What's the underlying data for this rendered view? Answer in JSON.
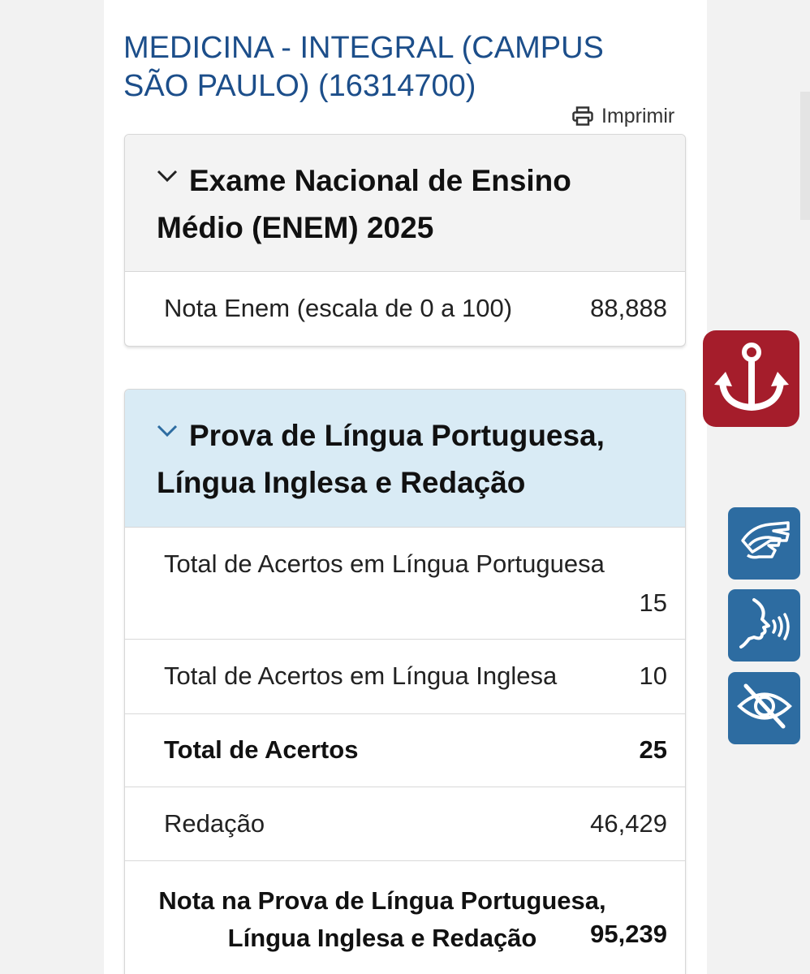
{
  "course": {
    "title": "MEDICINA - INTEGRAL (CAMPUS SÃO PAULO) (16314700)"
  },
  "print": {
    "label": "Imprimir",
    "icon": "printer-icon"
  },
  "enem_section": {
    "title": "Exame Nacional de Ensino Médio (ENEM) 2025",
    "rows": [
      {
        "label": "Nota Enem (escala de 0 a 100)",
        "value": "88,888"
      }
    ]
  },
  "prova_section": {
    "title": "Prova de Língua Portuguesa, Língua Inglesa e Redação",
    "rows": [
      {
        "label": "Total de Acertos em Língua Portuguesa",
        "value": "15"
      },
      {
        "label": "Total de Acertos em Língua Inglesa",
        "value": "10"
      },
      {
        "label": "Total de Acertos",
        "value": "25"
      },
      {
        "label": "Redação",
        "value": "46,429"
      },
      {
        "label": "Nota na Prova de Língua Portuguesa, Língua Inglesa e Redação",
        "value": "95,239"
      }
    ]
  },
  "side_buttons": {
    "anchor_icon": "anchor-icon",
    "sign_language_icon": "sign-language-icon",
    "audio_description_icon": "speaking-head-icon",
    "low_vision_icon": "eye-slash-icon"
  },
  "colors": {
    "title_blue": "#1c4e8a",
    "enem_header_bg": "#f3f3f3",
    "prova_header_bg": "#d9ebf5",
    "anchor_red": "#a51d2b",
    "a11y_blue": "#2d6ca1"
  }
}
